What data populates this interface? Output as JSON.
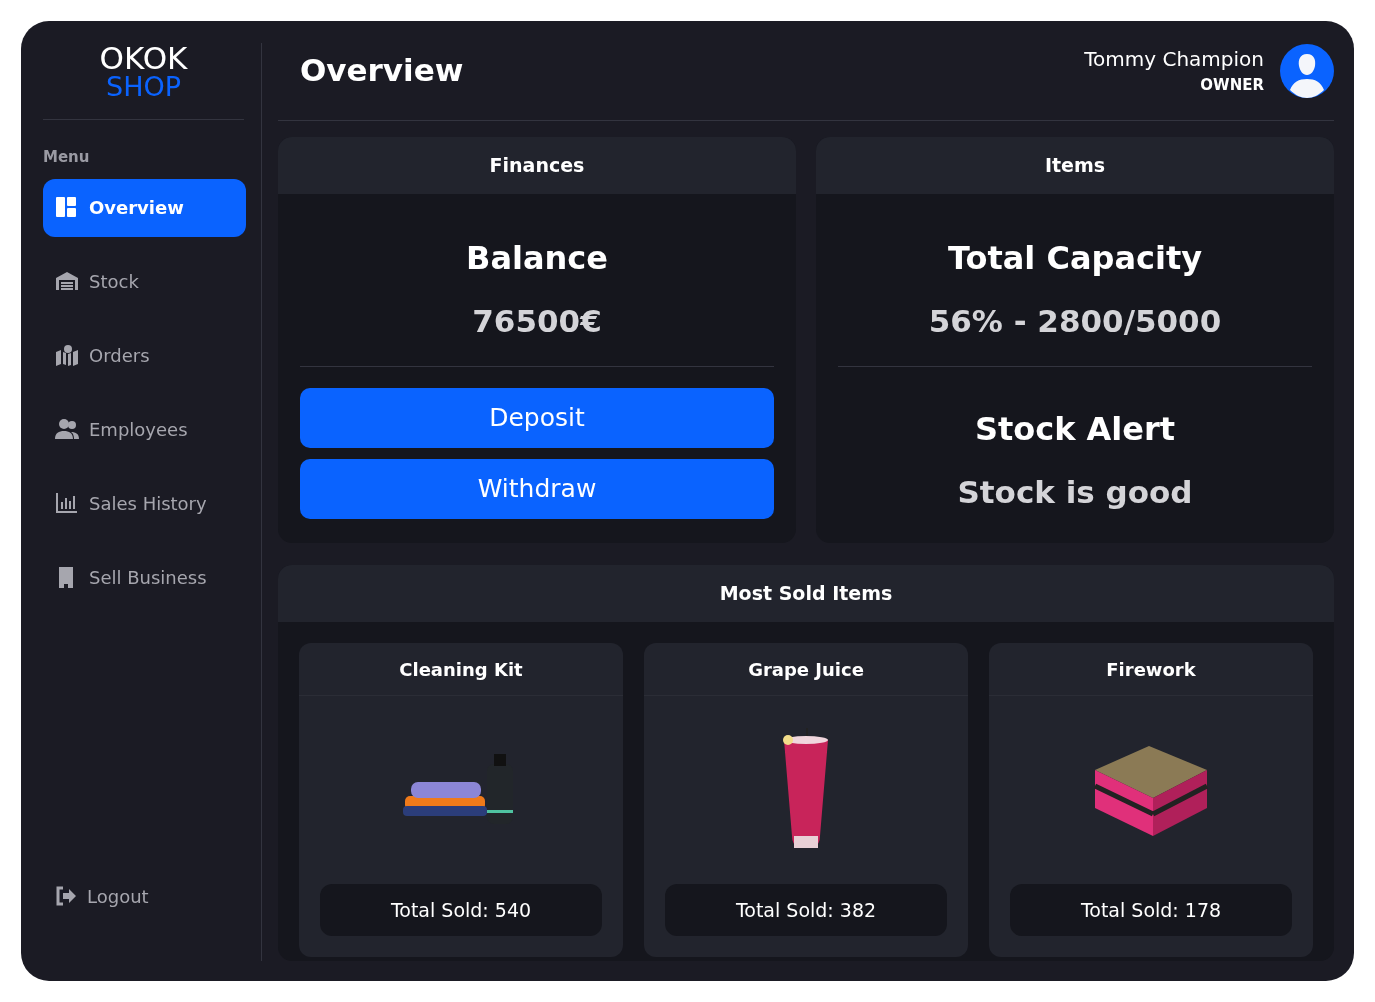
{
  "logo": {
    "line_1": "OKOK",
    "line_2": "SHOP"
  },
  "sidebar": {
    "heading": "Menu",
    "items": [
      {
        "label": "Overview",
        "selected": true
      },
      {
        "label": "Stock",
        "selected": false
      },
      {
        "label": "Orders",
        "selected": false
      },
      {
        "label": "Employees",
        "selected": false
      },
      {
        "label": "Sales History",
        "selected": false
      },
      {
        "label": "Sell Business",
        "selected": false
      }
    ],
    "logout": "Logout"
  },
  "header": {
    "title": "Overview",
    "user_name": "Tommy Champion",
    "user_role": "OWNER"
  },
  "finances": {
    "title": "Finances",
    "heading": "Balance",
    "value": "76500€",
    "buttons": [
      "Deposit",
      "Withdraw"
    ]
  },
  "items": {
    "title": "Items",
    "capacity_heading": "Total Capacity",
    "capacity_value": "56% - 2800/5000",
    "alert_heading": "Stock Alert",
    "alert_value": "Stock is good"
  },
  "most_sold": {
    "title": "Most Sold Items",
    "products": [
      {
        "name": "Cleaning Kit",
        "kind": "kit",
        "total": "Total Sold: 540"
      },
      {
        "name": "Grape Juice",
        "kind": "drink",
        "total": "Total Sold: 382"
      },
      {
        "name": "Firework",
        "kind": "crate",
        "total": "Total Sold: 178"
      }
    ]
  }
}
